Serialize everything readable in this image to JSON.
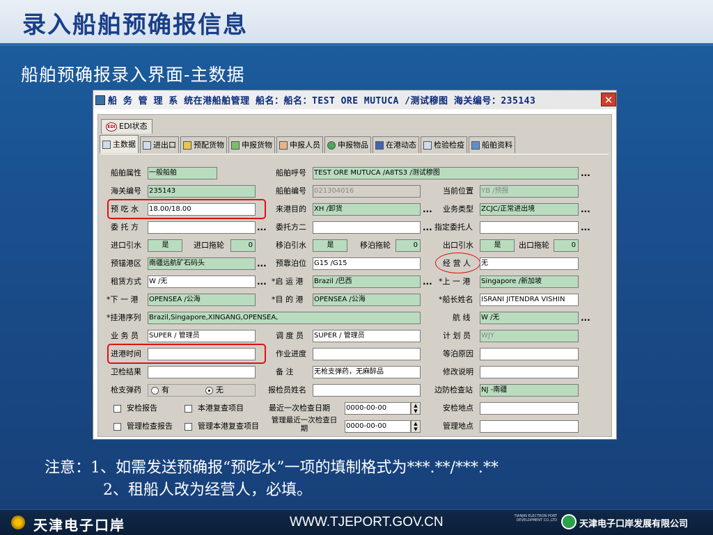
{
  "slide": {
    "title": "录入船舶预确报信息",
    "subtitle": "船舶预确报录入界面-主数据"
  },
  "window": {
    "title": "船 务 管 理 系 统在港船舶管理  船名：船名：TEST ORE MUTUCA /测试穆图  海关编号：235143",
    "close_label": "✕"
  },
  "edi_tab": {
    "badge": "EDI",
    "label": "EDI状态"
  },
  "tabs": [
    {
      "label": "主数据",
      "icon": "document-icon"
    },
    {
      "label": "进出口",
      "icon": "import-export-icon"
    },
    {
      "label": "预配货物",
      "icon": "cargo-icon"
    },
    {
      "label": "申报货物",
      "icon": "declare-cargo-icon"
    },
    {
      "label": "申报人员",
      "icon": "crew-icon"
    },
    {
      "label": "申报物品",
      "icon": "goods-icon"
    },
    {
      "label": "在港动态",
      "icon": "port-status-icon"
    },
    {
      "label": "检验检疫",
      "icon": "inspection-icon"
    },
    {
      "label": "船舶资料",
      "icon": "ship-info-icon"
    }
  ],
  "form": {
    "ship_attr": {
      "label": "船舶属性",
      "value": "一般船舶"
    },
    "call_sign": {
      "label": "船舶呼号",
      "value": "TEST ORE MUTUCA /A8TS3      /测试穆图"
    },
    "customs_no": {
      "label": "海关编号",
      "value": "235143"
    },
    "ship_no": {
      "label": "船舶编号",
      "value": "021304016"
    },
    "current_pos": {
      "label": "当前位置",
      "value": "YB   /预报"
    },
    "draft": {
      "label": "预 吃 水",
      "value": "18.00/18.00"
    },
    "purpose": {
      "label": "来港目的",
      "value": "XH  /卸货"
    },
    "biz_type": {
      "label": "业务类型",
      "value": "ZCJC/正常进出境"
    },
    "client": {
      "label": "委 托 方",
      "value": ""
    },
    "client2": {
      "label": "委托方二",
      "value": ""
    },
    "designated_client": {
      "label": "指定委托人",
      "value": ""
    },
    "in_pilot": {
      "label": "进口引水",
      "value": "是"
    },
    "in_tug": {
      "label": "进口拖轮",
      "value": "0"
    },
    "shift_pilot": {
      "label": "移泊引水",
      "value": "是"
    },
    "shift_tug": {
      "label": "移泊拖轮",
      "value": "0"
    },
    "out_pilot": {
      "label": "出口引水",
      "value": "是"
    },
    "out_tug": {
      "label": "出口拖轮",
      "value": "0"
    },
    "anchorage": {
      "label": "预锚港区",
      "value": "南疆远航矿石码头"
    },
    "berth": {
      "label": "预靠泊位",
      "value": "G15  /G15"
    },
    "operator": {
      "label": "经 营 人",
      "value": "无"
    },
    "charter": {
      "label": "租赁方式",
      "value": "W    /无"
    },
    "dep_port": {
      "label": "*启 运 港",
      "value": "Brazil /巴西"
    },
    "prev_port": {
      "label": "*上 一 港",
      "value": "Singapore /新加坡"
    },
    "next_port": {
      "label": "*下 一 港",
      "value": "OPENSEA /公海"
    },
    "dest_port": {
      "label": "*目 的 港",
      "value": "OPENSEA /公海"
    },
    "captain": {
      "label": "*船长姓名",
      "value": "ISRANI JITENDRA VISHIN"
    },
    "port_seq": {
      "label": "*挂港序列",
      "value": "Brazil,Singapore,XINGANG,OPENSEA,"
    },
    "route": {
      "label": "航    线",
      "value": "W    /无"
    },
    "clerk": {
      "label": "业 务 员",
      "value": "SUPER / 管理员"
    },
    "dispatcher": {
      "label": "调 度 员",
      "value": "SUPER / 管理员"
    },
    "planner": {
      "label": "计 划 员",
      "value": "WJY"
    },
    "arrival_time": {
      "label": "进港时间",
      "value": ""
    },
    "progress": {
      "label": "作业进度",
      "value": ""
    },
    "wait_reason": {
      "label": "等泊原因",
      "value": ""
    },
    "health_result": {
      "label": "卫检结果",
      "value": ""
    },
    "remark": {
      "label": "备    注",
      "value": "无枪支弹药，无麻醉品"
    },
    "edit_note": {
      "label": "修改说明",
      "value": ""
    },
    "arms": {
      "label": "枪支弹药",
      "opt_yes": "有",
      "opt_no": "无",
      "selected": "无"
    },
    "inspector": {
      "label": "报检员姓名",
      "value": ""
    },
    "border_station": {
      "label": "边防检查站",
      "value": "NJ  -南疆"
    },
    "security_report": {
      "label": "安检报告"
    },
    "port_recheck": {
      "label": "本港复查项目"
    },
    "last_inspect": {
      "label": "最近一次检查日期",
      "value": "0000-00-00"
    },
    "security_place": {
      "label": "安检地点",
      "value": ""
    },
    "mgmt_report": {
      "label": "管理检查报告"
    },
    "mgmt_recheck": {
      "label": "管理本港复查项目"
    },
    "mgmt_last_inspect": {
      "label": "管理最近一次检查日期",
      "value": "0000-00-00"
    },
    "mgmt_place": {
      "label": "管理地点",
      "value": ""
    },
    "ellipsis": "..."
  },
  "note": {
    "line1": "注意：1、如需发送预确报“预吃水”一项的填制格式为***.**/***.**",
    "line2": "2、租船人改为经营人，必填。"
  },
  "footer": {
    "brand": "天津电子口岸",
    "url": "WWW.TJEPORT.GOV.CN",
    "small_text": "TIANJIN ELECTRON PORT DEVELOPMENT CO.,LTD",
    "company": "天津电子口岸发展有限公司"
  },
  "colors": {
    "field_green": "#b9dcbf",
    "highlight_red": "#d11111",
    "title_blue": "#1a3f88"
  }
}
